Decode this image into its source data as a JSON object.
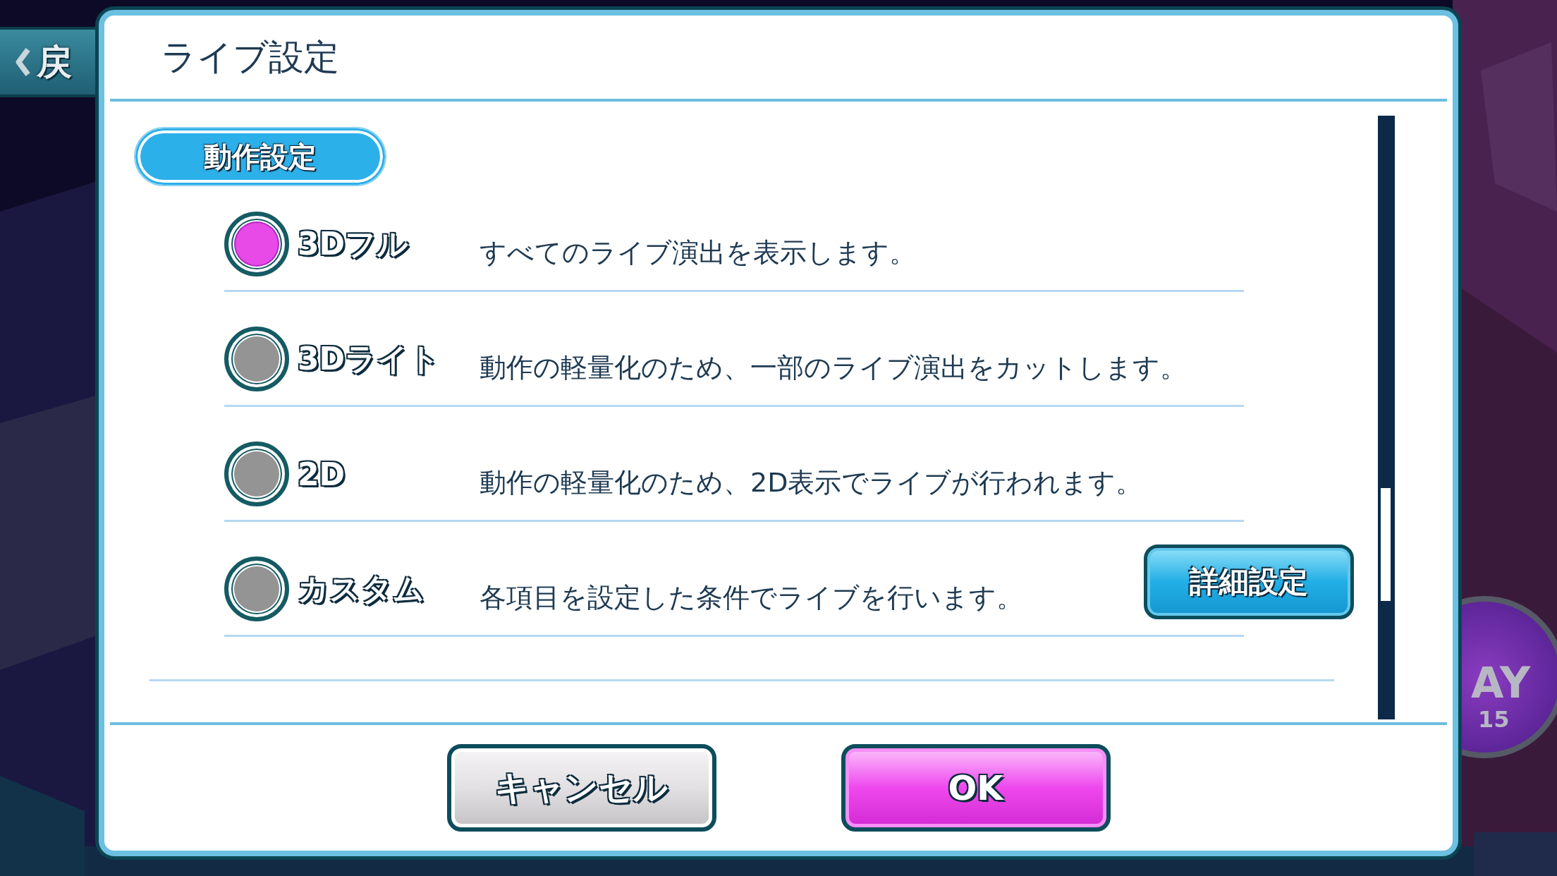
{
  "back_button": {
    "label": "戻"
  },
  "badge": {
    "line_1": "AY",
    "line_2": "15"
  },
  "dialog": {
    "title": "ライブ設定",
    "section_header": "動作設定",
    "options": [
      {
        "label": "3Dフル",
        "description": "すべてのライブ演出を表示します。",
        "selected": true
      },
      {
        "label": "3Dライト",
        "description": "動作の軽量化のため、一部のライブ演出をカットします。",
        "selected": false
      },
      {
        "label": "2D",
        "description": "動作の軽量化のため、2D表示でライブが行われます。",
        "selected": false
      },
      {
        "label": "カスタム",
        "description": "各項目を設定した条件でライブを行います。",
        "selected": false,
        "button": "詳細設定"
      }
    ],
    "buttons": [
      {
        "label": "キャンセル",
        "kind": "cancel"
      },
      {
        "label": "OK",
        "kind": "ok"
      }
    ]
  }
}
